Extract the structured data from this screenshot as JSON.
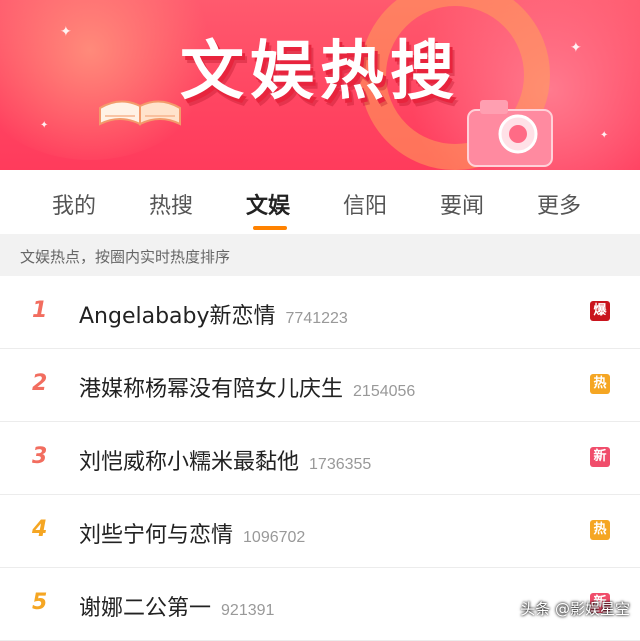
{
  "banner": {
    "title": "文娱热搜"
  },
  "tabs": [
    {
      "label": "我的",
      "active": false
    },
    {
      "label": "热搜",
      "active": false
    },
    {
      "label": "文娱",
      "active": true
    },
    {
      "label": "信阳",
      "active": false
    },
    {
      "label": "要闻",
      "active": false
    },
    {
      "label": "更多",
      "active": false
    }
  ],
  "subheader": "文娱热点，按圈内实时热度排序",
  "list": [
    {
      "rank": "1",
      "topic": "Angelababy新恋情",
      "count": "7741223",
      "badge": "爆",
      "badge_color": "#c9151e"
    },
    {
      "rank": "2",
      "topic": "港媒称杨幂没有陪女儿庆生",
      "count": "2154056",
      "badge": "热",
      "badge_color": "#f5a623"
    },
    {
      "rank": "3",
      "topic": "刘恺威称小糯米最黏他",
      "count": "1736355",
      "badge": "新",
      "badge_color": "#f04d6b"
    },
    {
      "rank": "4",
      "topic": "刘些宁何与恋情",
      "count": "1096702",
      "badge": "热",
      "badge_color": "#f5a623"
    },
    {
      "rank": "5",
      "topic": "谢娜二公第一",
      "count": "921391",
      "badge": "新",
      "badge_color": "#f04d6b"
    }
  ],
  "watermark": "头条 @影娱星空"
}
